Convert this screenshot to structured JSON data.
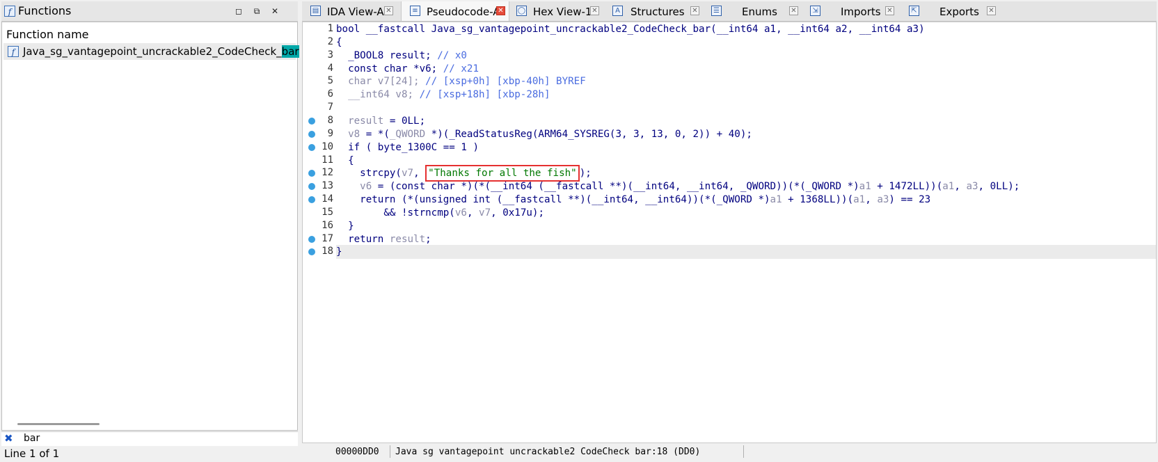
{
  "functions_panel": {
    "title": "Functions",
    "column_header": "Function name",
    "items": [
      {
        "name_prefix": "Java_sg_vantagepoint_uncrackable2_CodeCheck_",
        "name_match": "bar"
      }
    ],
    "search_query": "bar",
    "status": "Line 1 of 1"
  },
  "tabs": [
    {
      "label": "IDA View-A",
      "icon": "graph-icon",
      "active": false
    },
    {
      "label": "Pseudocode-A",
      "icon": "pseudocode-icon",
      "active": true
    },
    {
      "label": "Hex View-1",
      "icon": "hex-icon",
      "active": false
    },
    {
      "label": "Structures",
      "icon": "structures-icon",
      "active": false
    },
    {
      "label": "Enums",
      "icon": "enums-icon",
      "active": false
    },
    {
      "label": "Imports",
      "icon": "imports-icon",
      "active": false
    },
    {
      "label": "Exports",
      "icon": "exports-icon",
      "active": false
    }
  ],
  "code": {
    "lines": [
      {
        "n": "1",
        "bp": false,
        "segs": [
          [
            "",
            "bool __fastcall Java_sg_vantagepoint_uncrackable2_CodeCheck_bar(__int64 a1, __int64 a2, __int64 a3)"
          ]
        ]
      },
      {
        "n": "2",
        "bp": false,
        "segs": [
          [
            "",
            "{"
          ]
        ]
      },
      {
        "n": "3",
        "bp": false,
        "segs": [
          [
            "",
            "  _BOOL8 result; "
          ],
          [
            "cm",
            "// x0"
          ]
        ]
      },
      {
        "n": "4",
        "bp": false,
        "segs": [
          [
            "",
            "  const char *v6; "
          ],
          [
            "cm",
            "// x21"
          ]
        ]
      },
      {
        "n": "5",
        "bp": false,
        "segs": [
          [
            "gray",
            "  char v7[24]; "
          ],
          [
            "cm",
            "// [xsp+0h] [xbp-40h] BYREF"
          ]
        ]
      },
      {
        "n": "6",
        "bp": false,
        "segs": [
          [
            "gray",
            "  __int64 v8; "
          ],
          [
            "cm",
            "// [xsp+18h] [xbp-28h]"
          ]
        ]
      },
      {
        "n": "7",
        "bp": false,
        "segs": [
          [
            "",
            ""
          ]
        ]
      },
      {
        "n": "8",
        "bp": true,
        "segs": [
          [
            "gray",
            "  result"
          ],
          [
            "",
            " = 0LL;"
          ]
        ]
      },
      {
        "n": "9",
        "bp": true,
        "segs": [
          [
            "gray",
            "  v8"
          ],
          [
            "",
            " = *("
          ],
          [
            "gray",
            "_QWORD"
          ],
          [
            "",
            " *)(_ReadStatusReg(ARM64_SYSREG(3, 3, 13, 0, 2)) + 40);"
          ]
        ]
      },
      {
        "n": "10",
        "bp": true,
        "segs": [
          [
            "",
            "  if ( byte_1300C == 1 )"
          ]
        ]
      },
      {
        "n": "11",
        "bp": false,
        "segs": [
          [
            "",
            "  {"
          ]
        ]
      },
      {
        "n": "12",
        "bp": true,
        "segs": [
          [
            "",
            "    strcpy("
          ],
          [
            "gray",
            "v7"
          ],
          [
            "",
            ", "
          ],
          [
            "box",
            "\"Thanks for all the fish\""
          ],
          [
            "",
            ");"
          ]
        ]
      },
      {
        "n": "13",
        "bp": true,
        "segs": [
          [
            "gray",
            "    v6"
          ],
          [
            "",
            " = (const char *)(*(__int64 (__fastcall **)(__int64, __int64, _QWORD))(*(_QWORD *)"
          ],
          [
            "gray",
            "a1"
          ],
          [
            "",
            " + 1472LL))("
          ],
          [
            "gray",
            "a1"
          ],
          [
            "",
            ", "
          ],
          [
            "gray",
            "a3"
          ],
          [
            "",
            ", 0LL);"
          ]
        ]
      },
      {
        "n": "14",
        "bp": true,
        "segs": [
          [
            "",
            "    return (*(unsigned int (__fastcall **)(__int64, __int64))(*(_QWORD *)"
          ],
          [
            "gray",
            "a1"
          ],
          [
            "",
            " + 1368LL))("
          ],
          [
            "gray",
            "a1"
          ],
          [
            "",
            ", "
          ],
          [
            "gray",
            "a3"
          ],
          [
            "",
            ") == 23"
          ]
        ]
      },
      {
        "n": "15",
        "bp": false,
        "segs": [
          [
            "",
            "        && !strncmp("
          ],
          [
            "gray",
            "v6"
          ],
          [
            "",
            ", "
          ],
          [
            "gray",
            "v7"
          ],
          [
            "",
            ", 0x17u);"
          ]
        ]
      },
      {
        "n": "16",
        "bp": false,
        "segs": [
          [
            "",
            "  }"
          ]
        ]
      },
      {
        "n": "17",
        "bp": true,
        "segs": [
          [
            "",
            "  return "
          ],
          [
            "gray",
            "result"
          ],
          [
            "",
            ";"
          ]
        ]
      },
      {
        "n": "18",
        "bp": true,
        "segs": [
          [
            "",
            "}"
          ]
        ]
      }
    ],
    "status_address": "00000DD0",
    "status_location": "Java sg vantagepoint uncrackable2 CodeCheck bar:18 (DD0)"
  },
  "colors": {
    "breakpoint": "#3aa0e0",
    "highlight": "#00a8a8",
    "string": "#007800",
    "comment": "#4a6ce0",
    "annotation_box": "#e53030"
  }
}
